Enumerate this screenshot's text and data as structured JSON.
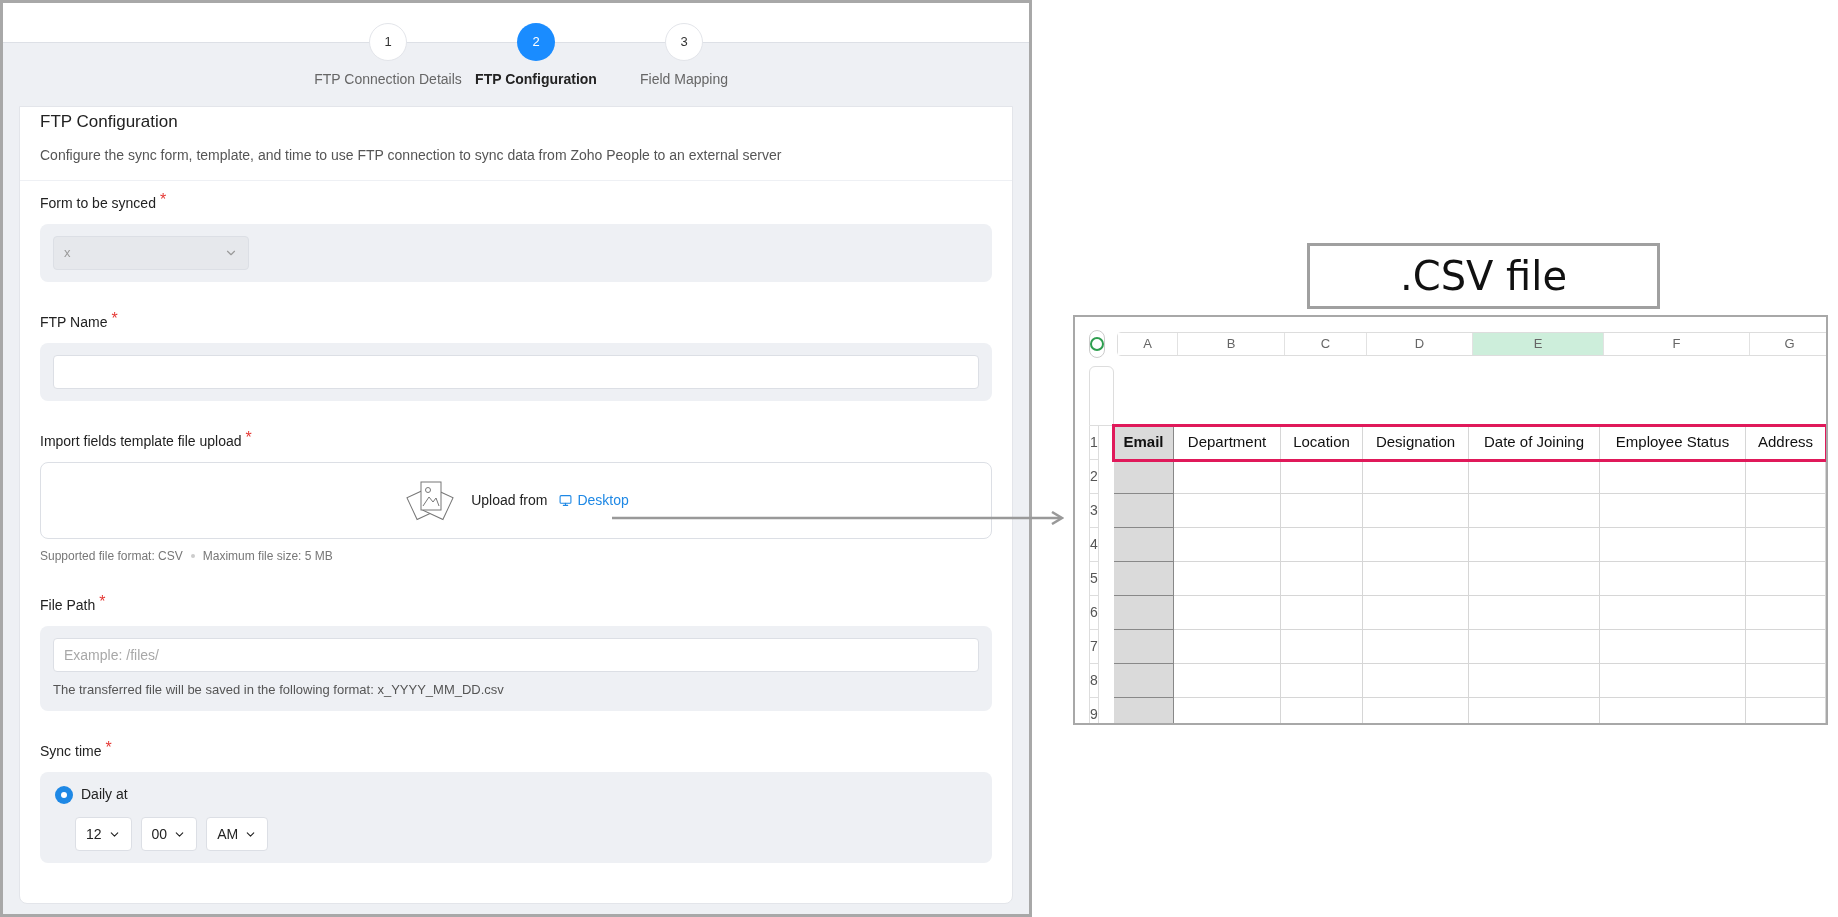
{
  "stepper": {
    "steps": [
      {
        "number": "1",
        "label": "FTP Connection Details",
        "selected": false
      },
      {
        "number": "2",
        "label": "FTP Configuration",
        "selected": true
      },
      {
        "number": "3",
        "label": "Field Mapping",
        "selected": false
      }
    ]
  },
  "form": {
    "title": "FTP Configuration",
    "description": "Configure the sync form, template, and time to use FTP connection to sync data from Zoho People to an external server",
    "fields": [
      {
        "kind": "select",
        "label": "Form to be synced",
        "required_mark": "*",
        "value": "x",
        "disabled": true
      },
      {
        "kind": "text",
        "label": "FTP Name",
        "required_mark": "*"
      },
      {
        "kind": "upload",
        "label": "Import fields template file upload",
        "required_mark": "*",
        "upload_text": "Upload from",
        "link": "Desktop",
        "hints": [
          "Supported file format: CSV",
          "Maximum file size: 5 MB"
        ]
      },
      {
        "kind": "text",
        "label": "File Path",
        "required_mark": "*",
        "placeholder": "Example: /files/",
        "note": "The transferred file will be saved in the following format: x_YYYY_MM_DD.csv"
      },
      {
        "kind": "time",
        "label": "Sync time",
        "required_mark": "*",
        "option": {
          "label": "Daily at",
          "selected": true
        },
        "selects": [
          "12",
          "00",
          "AM"
        ]
      }
    ]
  },
  "annotation": {
    "label": ".CSV file"
  },
  "spreadsheet": {
    "columns": [
      {
        "letter": "A",
        "selected": false,
        "shaded": true
      },
      {
        "letter": "B",
        "selected": false,
        "shaded": false
      },
      {
        "letter": "C",
        "selected": false,
        "shaded": false
      },
      {
        "letter": "D",
        "selected": false,
        "shaded": false
      },
      {
        "letter": "E",
        "selected": true,
        "shaded": false
      },
      {
        "letter": "F",
        "selected": false,
        "shaded": false
      },
      {
        "letter": "G",
        "selected": false,
        "shaded": false
      }
    ],
    "rows": [
      {
        "number": "1",
        "outlined": true,
        "cells": [
          "Email",
          "Department",
          "Location",
          "Designation",
          "Date of Joining",
          "Employee Status",
          "Address"
        ]
      },
      {
        "number": "2",
        "outlined": false,
        "cells": []
      },
      {
        "number": "3",
        "outlined": false,
        "cells": []
      },
      {
        "number": "4",
        "outlined": false,
        "cells": []
      },
      {
        "number": "5",
        "outlined": false,
        "cells": []
      },
      {
        "number": "6",
        "outlined": false,
        "cells": []
      },
      {
        "number": "7",
        "outlined": false,
        "cells": []
      },
      {
        "number": "8",
        "outlined": false,
        "cells": []
      },
      {
        "number": "9",
        "outlined": false,
        "cells": []
      }
    ]
  }
}
